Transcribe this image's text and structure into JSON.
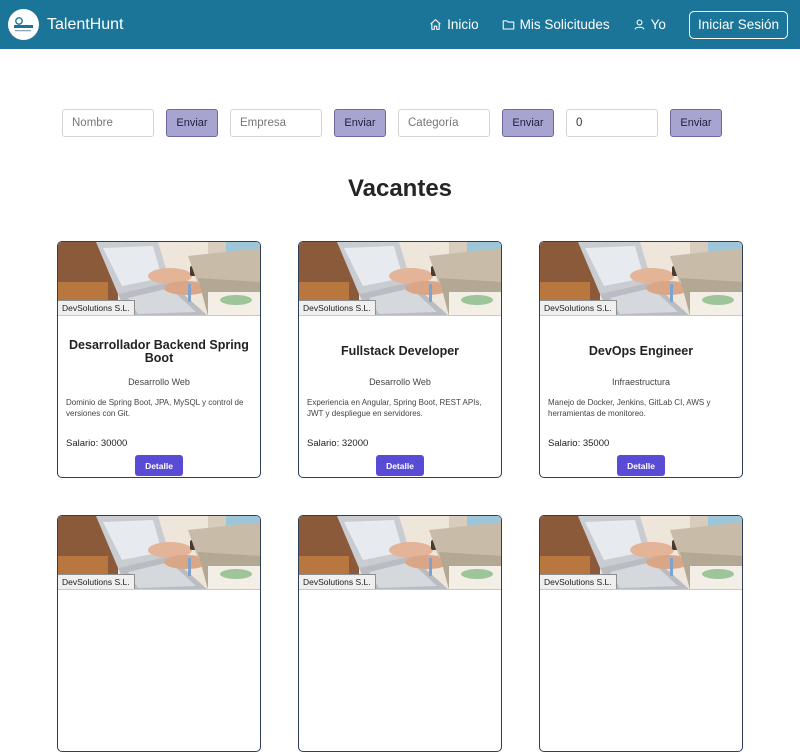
{
  "navbar": {
    "brand": "TalentHunt",
    "logo_text": "TalentHunt",
    "links": [
      {
        "label": "Inicio",
        "icon": "home-icon"
      },
      {
        "label": "Mis Solicitudes",
        "icon": "folder-icon"
      },
      {
        "label": "Yo",
        "icon": "user-icon"
      }
    ],
    "login_label": "Iniciar Sesión"
  },
  "filters": [
    {
      "placeholder": "Nombre",
      "value": "",
      "button": "Enviar"
    },
    {
      "placeholder": "Empresa",
      "value": "",
      "button": "Enviar"
    },
    {
      "placeholder": "Categoría",
      "value": "",
      "button": "Enviar"
    },
    {
      "placeholder": "",
      "value": "0",
      "button": "Enviar"
    }
  ],
  "section_title": "Vacantes",
  "cards": [
    {
      "company": "DevSolutions S.L.",
      "title": "Desarrollador Backend Spring Boot",
      "category": "Desarrollo Web",
      "description": "Dominio de Spring Boot, JPA, MySQL y control de versiones con Git.",
      "salary": "Salario: 30000",
      "button": "Detalle"
    },
    {
      "company": "DevSolutions S.L.",
      "title": "Fullstack Developer",
      "category": "Desarrollo Web",
      "description": "Experiencia en Angular, Spring Boot, REST APIs, JWT y despliegue en servidores.",
      "salary": "Salario: 32000",
      "button": "Detalle"
    },
    {
      "company": "DevSolutions S.L.",
      "title": "DevOps Engineer",
      "category": "Infraestructura",
      "description": "Manejo de Docker, Jenkins, GitLab CI, AWS y herramientas de monitoreo.",
      "salary": "Salario: 35000",
      "button": "Detalle"
    },
    {
      "company": "DevSolutions S.L."
    },
    {
      "company": "DevSolutions S.L."
    },
    {
      "company": "DevSolutions S.L."
    }
  ],
  "colors": {
    "navbar": "#1b7599",
    "filter_button": "#a8a4d2",
    "detail_button": "#5a4bd6",
    "card_border": "#2f3d58"
  }
}
